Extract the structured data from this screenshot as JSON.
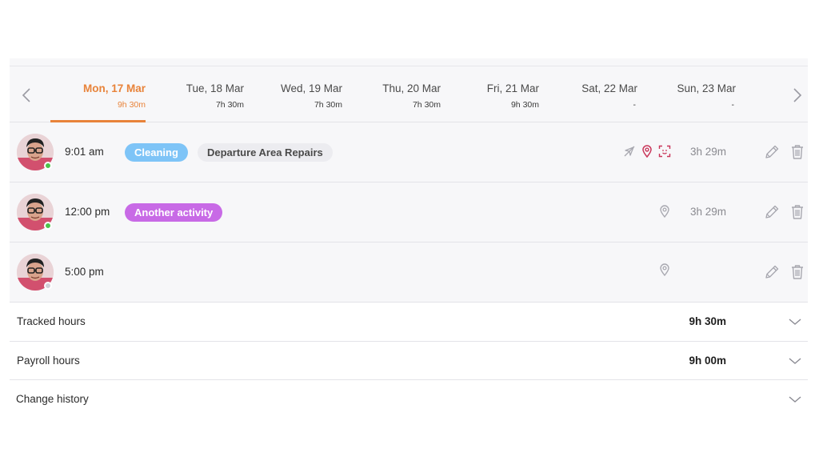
{
  "week": {
    "days": [
      {
        "label": "Mon, 17 Mar",
        "hours": "9h 30m",
        "active": true
      },
      {
        "label": "Tue, 18 Mar",
        "hours": "7h 30m",
        "active": false
      },
      {
        "label": "Wed, 19 Mar",
        "hours": "7h 30m",
        "active": false
      },
      {
        "label": "Thu, 20 Mar",
        "hours": "7h 30m",
        "active": false
      },
      {
        "label": "Fri, 21 Mar",
        "hours": "9h 30m",
        "active": false
      },
      {
        "label": "Sat, 22 Mar",
        "hours": "-",
        "active": false
      },
      {
        "label": "Sun, 23 Mar",
        "hours": "-",
        "active": false
      }
    ]
  },
  "entries": [
    {
      "time": "9:01 am",
      "activity": "Cleaning",
      "project": "Departure Area Repairs",
      "duration": "3h 29m",
      "status": "online",
      "icons": [
        "no-gps-icon",
        "location-pin-icon",
        "face-scan-icon"
      ]
    },
    {
      "time": "12:00 pm",
      "activity": "Another activity",
      "project": "",
      "duration": "3h 29m",
      "status": "online",
      "icons": [
        "location-pin-icon"
      ]
    },
    {
      "time": "5:00 pm",
      "activity": "",
      "project": "",
      "duration": "",
      "status": "offline",
      "icons": [
        "location-pin-icon"
      ]
    }
  ],
  "summary": {
    "tracked": {
      "label": "Tracked hours",
      "value": "9h 30m"
    },
    "payroll": {
      "label": "Payroll hours",
      "value": "9h 00m"
    },
    "history": {
      "label": "Change history",
      "value": ""
    }
  },
  "colors": {
    "accent": "#e8833a",
    "activity_cleaning": "#7ec4f7",
    "activity_other": "#c86ae6",
    "online": "#4cc24a",
    "location_active": "#c9365a"
  }
}
